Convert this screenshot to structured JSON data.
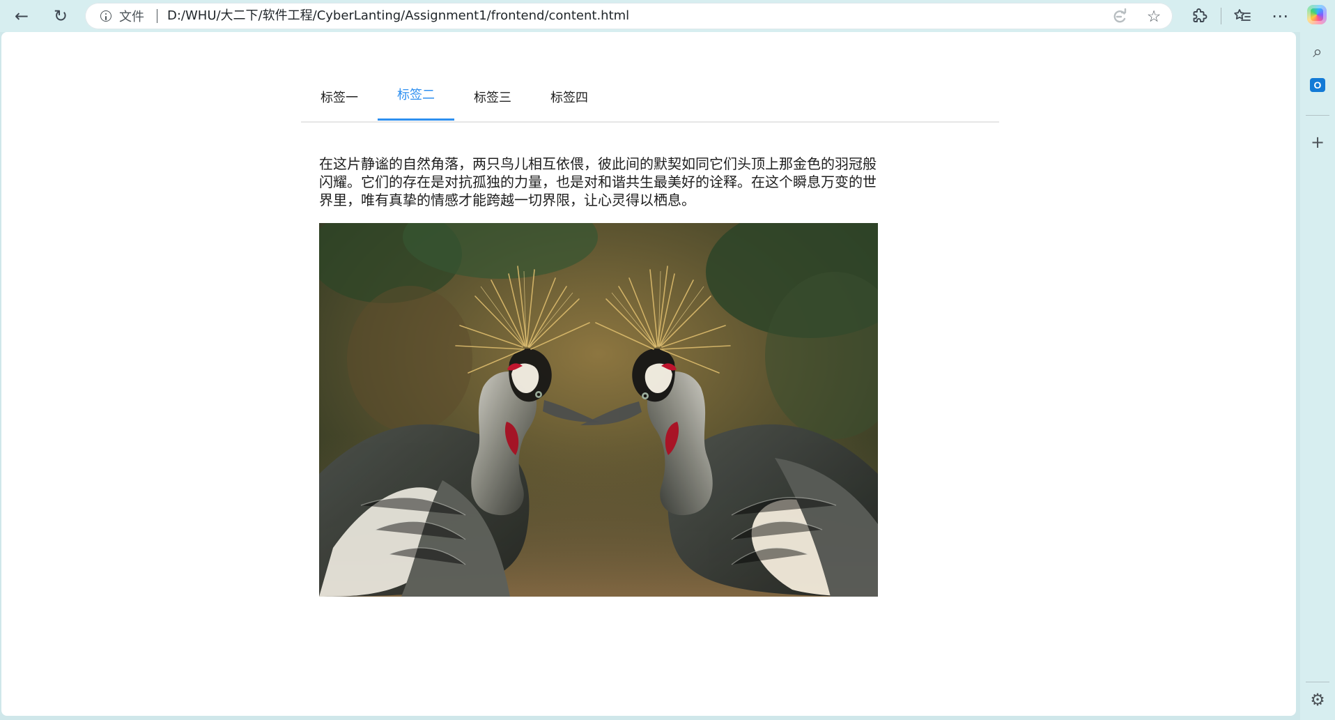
{
  "browser": {
    "address": {
      "site_label": "文件",
      "url": "D:/WHU/大二下/软件工程/CyberLanting/Assignment1/frontend/content.html"
    }
  },
  "page": {
    "tabs": [
      {
        "label": "标签一",
        "active": false
      },
      {
        "label": "标签二",
        "active": true
      },
      {
        "label": "标签三",
        "active": false
      },
      {
        "label": "标签四",
        "active": false
      }
    ],
    "paragraph": "在这片静谧的自然角落，两只鸟儿相互依偎，彼此间的默契如同它们头顶上那金色的羽冠般闪耀。它们的存在是对抗孤独的力量，也是对和谐共生最美好的诠释。在这个瞬息万变的世界里，唯有真挚的情感才能跨越一切界限，让心灵得以栖息。"
  },
  "colors": {
    "active_tab": "#2d8ff0",
    "browser_chrome": "#d7eef0",
    "page_background": "#ffffff"
  },
  "icons": {
    "toolbar": [
      "back-arrow-icon",
      "refresh-icon",
      "info-icon",
      "read-aloud-icon",
      "favorite-star-icon",
      "extensions-icon",
      "favorites-icon",
      "more-icon",
      "copilot-icon"
    ],
    "sidebar": [
      "search-icon",
      "outlook-icon",
      "add-icon",
      "settings-icon"
    ]
  }
}
